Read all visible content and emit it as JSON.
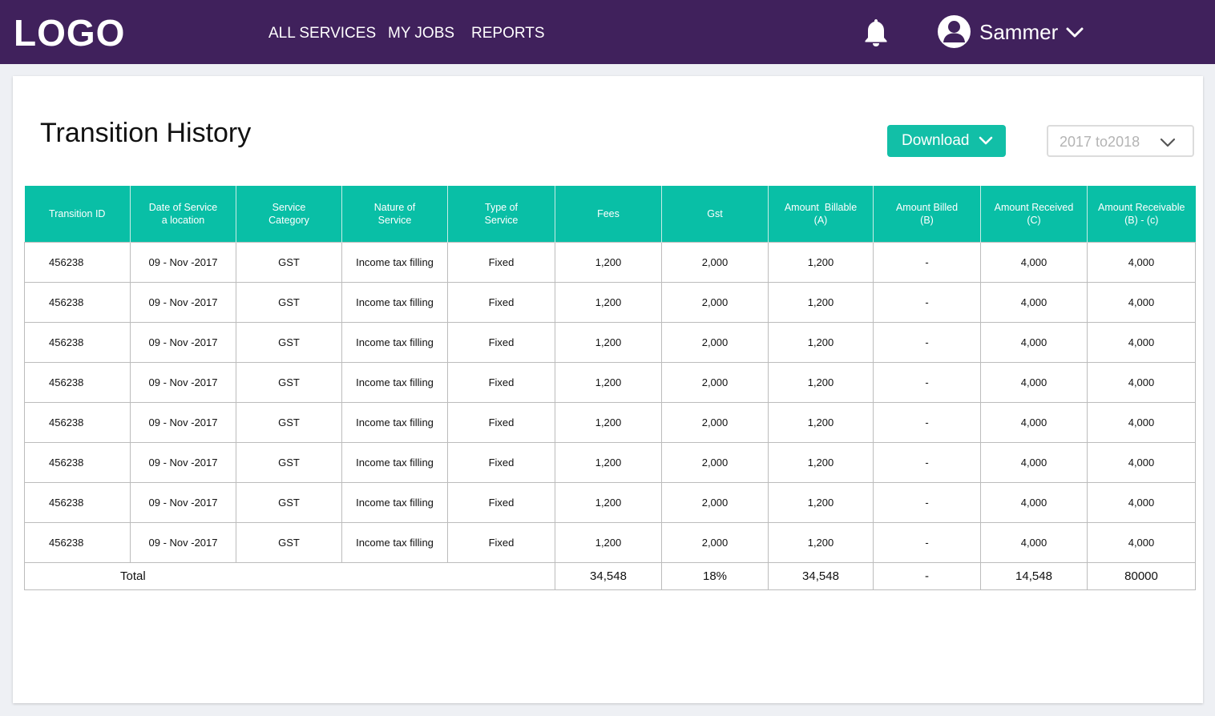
{
  "header": {
    "logo": "LOGO",
    "nav": [
      "ALL SERVICES",
      "MY JOBS",
      "REPORTS"
    ],
    "user_name": "Sammer",
    "brand_color": "#40215c",
    "icons": [
      "bell-icon",
      "user-avatar-icon",
      "chevron-down-icon"
    ]
  },
  "page": {
    "title": "Transition History",
    "download_label": "Download",
    "year_range": "2017 to2018",
    "accent_color": "#12bfa7"
  },
  "table": {
    "headers": [
      [
        "Transition ID"
      ],
      [
        "Date of Service",
        "a location"
      ],
      [
        "Service",
        "Category"
      ],
      [
        "Nature of",
        "Service"
      ],
      [
        "Type of",
        "Service"
      ],
      [
        "Fees"
      ],
      [
        "Gst"
      ],
      [
        "Amount  Billable",
        "(A)"
      ],
      [
        "Amount Billed",
        "(B)"
      ],
      [
        "Amount Received",
        "(C)"
      ],
      [
        "Amount Receivable",
        "(B) - (c)"
      ]
    ],
    "rows": [
      [
        "456238",
        "09 - Nov -2017",
        "GST",
        "Income tax filling",
        "Fixed",
        "1,200",
        "2,000",
        "1,200",
        "-",
        "4,000",
        "4,000"
      ],
      [
        "456238",
        "09 - Nov -2017",
        "GST",
        "Income tax filling",
        "Fixed",
        "1,200",
        "2,000",
        "1,200",
        "-",
        "4,000",
        "4,000"
      ],
      [
        "456238",
        "09 - Nov -2017",
        "GST",
        "Income tax filling",
        "Fixed",
        "1,200",
        "2,000",
        "1,200",
        "-",
        "4,000",
        "4,000"
      ],
      [
        "456238",
        "09 - Nov -2017",
        "GST",
        "Income tax filling",
        "Fixed",
        "1,200",
        "2,000",
        "1,200",
        "-",
        "4,000",
        "4,000"
      ],
      [
        "456238",
        "09 - Nov -2017",
        "GST",
        "Income tax filling",
        "Fixed",
        "1,200",
        "2,000",
        "1,200",
        "-",
        "4,000",
        "4,000"
      ],
      [
        "456238",
        "09 - Nov -2017",
        "GST",
        "Income tax filling",
        "Fixed",
        "1,200",
        "2,000",
        "1,200",
        "-",
        "4,000",
        "4,000"
      ],
      [
        "456238",
        "09 - Nov -2017",
        "GST",
        "Income tax filling",
        "Fixed",
        "1,200",
        "2,000",
        "1,200",
        "-",
        "4,000",
        "4,000"
      ],
      [
        "456238",
        "09 - Nov -2017",
        "GST",
        "Income tax filling",
        "Fixed",
        "1,200",
        "2,000",
        "1,200",
        "-",
        "4,000",
        "4,000"
      ]
    ],
    "total": {
      "label": "Total",
      "values": [
        "34,548",
        "18%",
        "34,548",
        "-",
        "14,548",
        "80000"
      ]
    }
  }
}
